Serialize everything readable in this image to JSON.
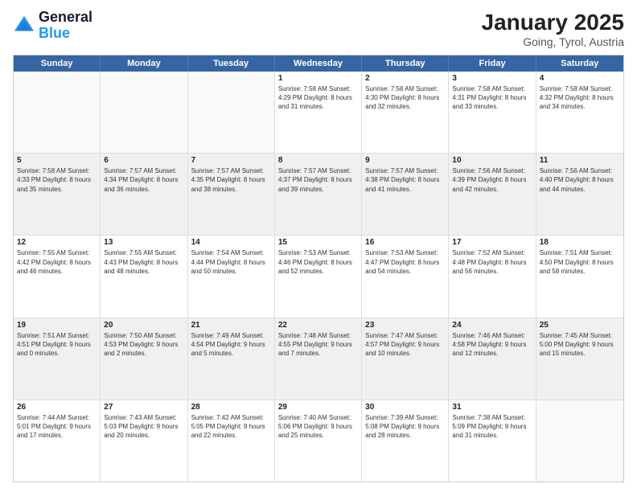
{
  "logo": {
    "line1": "General",
    "line2": "Blue"
  },
  "title": "January 2025",
  "subtitle": "Going, Tyrol, Austria",
  "days": [
    "Sunday",
    "Monday",
    "Tuesday",
    "Wednesday",
    "Thursday",
    "Friday",
    "Saturday"
  ],
  "weeks": [
    [
      {
        "day": "",
        "content": ""
      },
      {
        "day": "",
        "content": ""
      },
      {
        "day": "",
        "content": ""
      },
      {
        "day": "1",
        "content": "Sunrise: 7:58 AM\nSunset: 4:29 PM\nDaylight: 8 hours\nand 31 minutes."
      },
      {
        "day": "2",
        "content": "Sunrise: 7:58 AM\nSunset: 4:30 PM\nDaylight: 8 hours\nand 32 minutes."
      },
      {
        "day": "3",
        "content": "Sunrise: 7:58 AM\nSunset: 4:31 PM\nDaylight: 8 hours\nand 33 minutes."
      },
      {
        "day": "4",
        "content": "Sunrise: 7:58 AM\nSunset: 4:32 PM\nDaylight: 8 hours\nand 34 minutes."
      }
    ],
    [
      {
        "day": "5",
        "content": "Sunrise: 7:58 AM\nSunset: 4:33 PM\nDaylight: 8 hours\nand 35 minutes."
      },
      {
        "day": "6",
        "content": "Sunrise: 7:57 AM\nSunset: 4:34 PM\nDaylight: 8 hours\nand 36 minutes."
      },
      {
        "day": "7",
        "content": "Sunrise: 7:57 AM\nSunset: 4:35 PM\nDaylight: 8 hours\nand 38 minutes."
      },
      {
        "day": "8",
        "content": "Sunrise: 7:57 AM\nSunset: 4:37 PM\nDaylight: 8 hours\nand 39 minutes."
      },
      {
        "day": "9",
        "content": "Sunrise: 7:57 AM\nSunset: 4:38 PM\nDaylight: 8 hours\nand 41 minutes."
      },
      {
        "day": "10",
        "content": "Sunrise: 7:56 AM\nSunset: 4:39 PM\nDaylight: 8 hours\nand 42 minutes."
      },
      {
        "day": "11",
        "content": "Sunrise: 7:56 AM\nSunset: 4:40 PM\nDaylight: 8 hours\nand 44 minutes."
      }
    ],
    [
      {
        "day": "12",
        "content": "Sunrise: 7:55 AM\nSunset: 4:42 PM\nDaylight: 8 hours\nand 46 minutes."
      },
      {
        "day": "13",
        "content": "Sunrise: 7:55 AM\nSunset: 4:43 PM\nDaylight: 8 hours\nand 48 minutes."
      },
      {
        "day": "14",
        "content": "Sunrise: 7:54 AM\nSunset: 4:44 PM\nDaylight: 8 hours\nand 50 minutes."
      },
      {
        "day": "15",
        "content": "Sunrise: 7:53 AM\nSunset: 4:46 PM\nDaylight: 8 hours\nand 52 minutes."
      },
      {
        "day": "16",
        "content": "Sunrise: 7:53 AM\nSunset: 4:47 PM\nDaylight: 8 hours\nand 54 minutes."
      },
      {
        "day": "17",
        "content": "Sunrise: 7:52 AM\nSunset: 4:48 PM\nDaylight: 8 hours\nand 56 minutes."
      },
      {
        "day": "18",
        "content": "Sunrise: 7:51 AM\nSunset: 4:50 PM\nDaylight: 8 hours\nand 58 minutes."
      }
    ],
    [
      {
        "day": "19",
        "content": "Sunrise: 7:51 AM\nSunset: 4:51 PM\nDaylight: 9 hours\nand 0 minutes."
      },
      {
        "day": "20",
        "content": "Sunrise: 7:50 AM\nSunset: 4:53 PM\nDaylight: 9 hours\nand 2 minutes."
      },
      {
        "day": "21",
        "content": "Sunrise: 7:49 AM\nSunset: 4:54 PM\nDaylight: 9 hours\nand 5 minutes."
      },
      {
        "day": "22",
        "content": "Sunrise: 7:48 AM\nSunset: 4:55 PM\nDaylight: 9 hours\nand 7 minutes."
      },
      {
        "day": "23",
        "content": "Sunrise: 7:47 AM\nSunset: 4:57 PM\nDaylight: 9 hours\nand 10 minutes."
      },
      {
        "day": "24",
        "content": "Sunrise: 7:46 AM\nSunset: 4:58 PM\nDaylight: 9 hours\nand 12 minutes."
      },
      {
        "day": "25",
        "content": "Sunrise: 7:45 AM\nSunset: 5:00 PM\nDaylight: 9 hours\nand 15 minutes."
      }
    ],
    [
      {
        "day": "26",
        "content": "Sunrise: 7:44 AM\nSunset: 5:01 PM\nDaylight: 9 hours\nand 17 minutes."
      },
      {
        "day": "27",
        "content": "Sunrise: 7:43 AM\nSunset: 5:03 PM\nDaylight: 9 hours\nand 20 minutes."
      },
      {
        "day": "28",
        "content": "Sunrise: 7:42 AM\nSunset: 5:05 PM\nDaylight: 9 hours\nand 22 minutes."
      },
      {
        "day": "29",
        "content": "Sunrise: 7:40 AM\nSunset: 5:06 PM\nDaylight: 9 hours\nand 25 minutes."
      },
      {
        "day": "30",
        "content": "Sunrise: 7:39 AM\nSunset: 5:08 PM\nDaylight: 9 hours\nand 28 minutes."
      },
      {
        "day": "31",
        "content": "Sunrise: 7:38 AM\nSunset: 5:09 PM\nDaylight: 9 hours\nand 31 minutes."
      },
      {
        "day": "",
        "content": ""
      }
    ]
  ]
}
